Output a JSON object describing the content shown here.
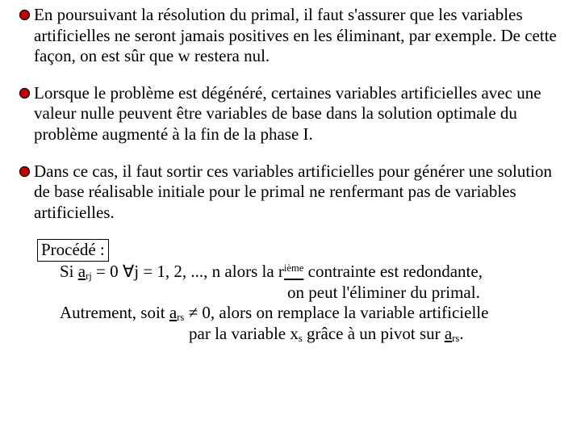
{
  "bullets": [
    "En poursuivant la résolution du primal, il faut s'assurer que les variables artificielles ne seront jamais positives en les éliminant, par exemple.  De cette façon, on est sûr que w restera nul.",
    "Lorsque le problème est dégénéré, certaines variables artificielles avec une valeur nulle peuvent être variables de base dans la solution optimale du problème augmenté à la fin de la phase I.",
    "Dans ce cas, il faut sortir ces variables artificielles pour générer une solution de base réalisable initiale pour le primal ne renfermant pas de variables artificielles."
  ],
  "proc": {
    "title": "Procédé :",
    "si_prefix": "Si ",
    "a": "a",
    "sub_rj": "rj",
    "si_mid": " = 0 ∀j = 1, 2, ..., n alors  la r",
    "ieme": "ième",
    "si_tail": " contrainte est redondante,",
    "line2": "on peut l'éliminer du primal.",
    "aut_prefix": "Autrement, soit ",
    "sub_rs": "rs",
    "aut_tail": " ≠ 0, alors on remplace la variable artificielle",
    "line4_prefix": "par la variable x",
    "sub_s": "s",
    "line4_mid": " grâce à un pivot sur ",
    "line4_tail": "."
  }
}
